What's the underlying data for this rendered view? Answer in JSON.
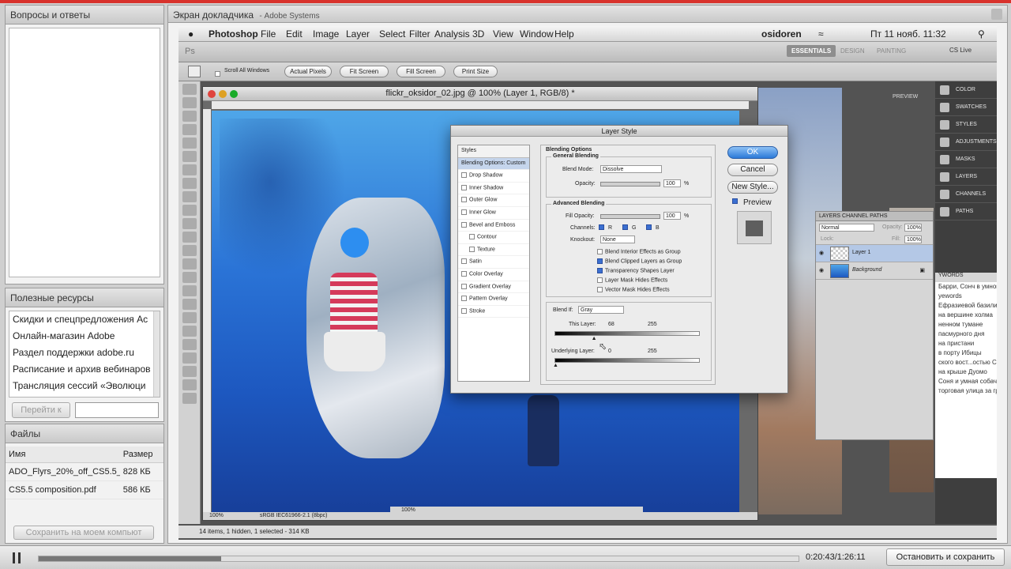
{
  "left_panel": {
    "qa": {
      "title": "Вопросы и ответы"
    },
    "resources": {
      "title": "Полезные ресурсы",
      "items": [
        "Скидки и спецпредложения Ac",
        "Онлайн-магазин Adobe",
        "Раздел поддержки adobe.ru",
        "Расписание и архив вебинаров",
        "Трансляция сессий «Эволюци"
      ],
      "go_button": "Перейти к"
    },
    "files": {
      "title": "Файлы",
      "col_name": "Имя",
      "col_size": "Размер",
      "rows": [
        {
          "name": "ADO_Flyrs_20%_off_CS5.5_",
          "size": "828 КБ"
        },
        {
          "name": "CS5.5 composition.pdf",
          "size": "586 КБ"
        }
      ],
      "save_button": "Сохранить на моем компьют"
    }
  },
  "share": {
    "title": "Экран докладчика",
    "subtitle": "- Adobe Systems"
  },
  "mac_menu": {
    "app": "Photoshop",
    "items": [
      "File",
      "Edit",
      "Image",
      "Layer",
      "Select",
      "Filter",
      "Analysis",
      "3D",
      "View",
      "Window",
      "Help"
    ],
    "user": "osidoren",
    "clock": "Пт 11 нояб.  11:32"
  },
  "ps": {
    "workspaces": [
      "ESSENTIALS",
      "DESIGN",
      "PAINTING"
    ],
    "cs_live": "CS Live",
    "options": {
      "scroll_all": "Scroll All Windows",
      "actual": "Actual Pixels",
      "fit": "Fit Screen",
      "fill": "Fill Screen",
      "print": "Print Size"
    },
    "doc_title": "flickr_oksidor_02.jpg @ 100% (Layer 1, RGB/8) *",
    "doc_zoom": "100%",
    "doc_profile": "sRGB IEC61966-2.1 (8bpc)",
    "bottom_doc_zoom": "100%",
    "status_bottom": "14 items, 1 hidden, 1 selected - 314 KB",
    "preview_label": "PREVIEW",
    "dock": [
      "COLOR",
      "SWATCHES",
      "STYLES",
      "ADJUSTMENTS",
      "MASKS",
      "LAYERS",
      "CHANNELS",
      "PATHS"
    ],
    "layers_panel": {
      "tabs": "LAYERS  CHANNEL  PATHS",
      "mode": "Normal",
      "opacity_label": "Opacity:",
      "opacity": "100%",
      "lock_label": "Lock:",
      "fill_label": "Fill:",
      "fill": "100%",
      "layer1": "Layer 1",
      "background": "Background"
    },
    "keywords_label": "YWORDS",
    "history": [
      "Барри, Сонч в умной",
      "yewords",
      "Ефразиевой базили",
      "на вершине холма",
      "ненном тумане",
      "пасмурного дня",
      "на пристани",
      "в порту Ибицы",
      "ского вост...остью С",
      "на крыше Дуомо",
      "Соня и умная собачка",
      "торговая улица за гранд-"
    ]
  },
  "dialog": {
    "title": "Layer Style",
    "styles_header": "Styles",
    "styles": [
      {
        "label": "Blending Options: Custom",
        "selected": true
      },
      {
        "label": "Drop Shadow"
      },
      {
        "label": "Inner Shadow"
      },
      {
        "label": "Outer Glow"
      },
      {
        "label": "Inner Glow"
      },
      {
        "label": "Bevel and Emboss"
      },
      {
        "label": "Contour"
      },
      {
        "label": "Texture"
      },
      {
        "label": "Satin"
      },
      {
        "label": "Color Overlay"
      },
      {
        "label": "Gradient Overlay"
      },
      {
        "label": "Pattern Overlay"
      },
      {
        "label": "Stroke"
      }
    ],
    "blending_options": "Blending Options",
    "general_blending": "General Blending",
    "blend_mode_label": "Blend Mode:",
    "blend_mode": "Dissolve",
    "opacity_label": "Opacity:",
    "opacity": "100",
    "pct": "%",
    "advanced_blending": "Advanced Blending",
    "fill_opacity_label": "Fill Opacity:",
    "fill_opacity": "100",
    "channels_label": "Channels:",
    "ch_r": "R",
    "ch_g": "G",
    "ch_b": "B",
    "knockout_label": "Knockout:",
    "knockout": "None",
    "checks": [
      {
        "label": "Blend Interior Effects as Group",
        "on": false
      },
      {
        "label": "Blend Clipped Layers as Group",
        "on": true
      },
      {
        "label": "Transparency Shapes Layer",
        "on": true
      },
      {
        "label": "Layer Mask Hides Effects",
        "on": false
      },
      {
        "label": "Vector Mask Hides Effects",
        "on": false
      }
    ],
    "blend_if_label": "Blend If:",
    "blend_if": "Gray",
    "this_layer_label": "This Layer:",
    "this_low": "68",
    "this_high": "255",
    "this_low_frac": 0.27,
    "underlying_label": "Underlying Layer:",
    "under_low": "0",
    "under_high": "255",
    "ok": "OK",
    "cancel": "Cancel",
    "new_style": "New Style...",
    "preview": "Preview"
  },
  "player": {
    "time": "0:20:43/1:26:11",
    "stop_button": "Остановить и сохранить",
    "progress_fraction": 0.24
  }
}
